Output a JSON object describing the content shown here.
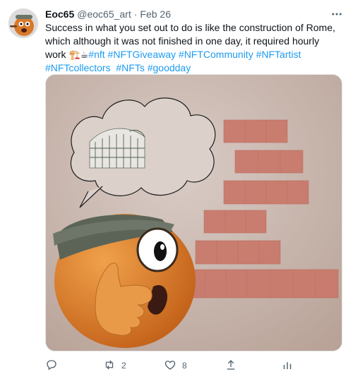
{
  "tweet": {
    "name": "Eoc65",
    "handle": "@eoc65_art",
    "separator": "·",
    "date": "Feb 26",
    "text_main": "Success in what you set out to do is like the construction of Rome, which although it was not finished in one day, it required hourly work ",
    "emoji": "🏗️☕",
    "hashtags": [
      "#nft",
      "#NFTGiveaway",
      "#NFTCommunity",
      "#NFTartist",
      "#NFTcollectors",
      "#NFTs",
      "#goodday"
    ],
    "more_icon": "more-dots-icon",
    "actions": {
      "reply_icon": "reply-icon",
      "retweet_icon": "retweet-icon",
      "retweet_count": "2",
      "like_icon": "heart-icon",
      "like_count": "8",
      "share_icon": "share-icon",
      "views_icon": "views-icon"
    }
  }
}
